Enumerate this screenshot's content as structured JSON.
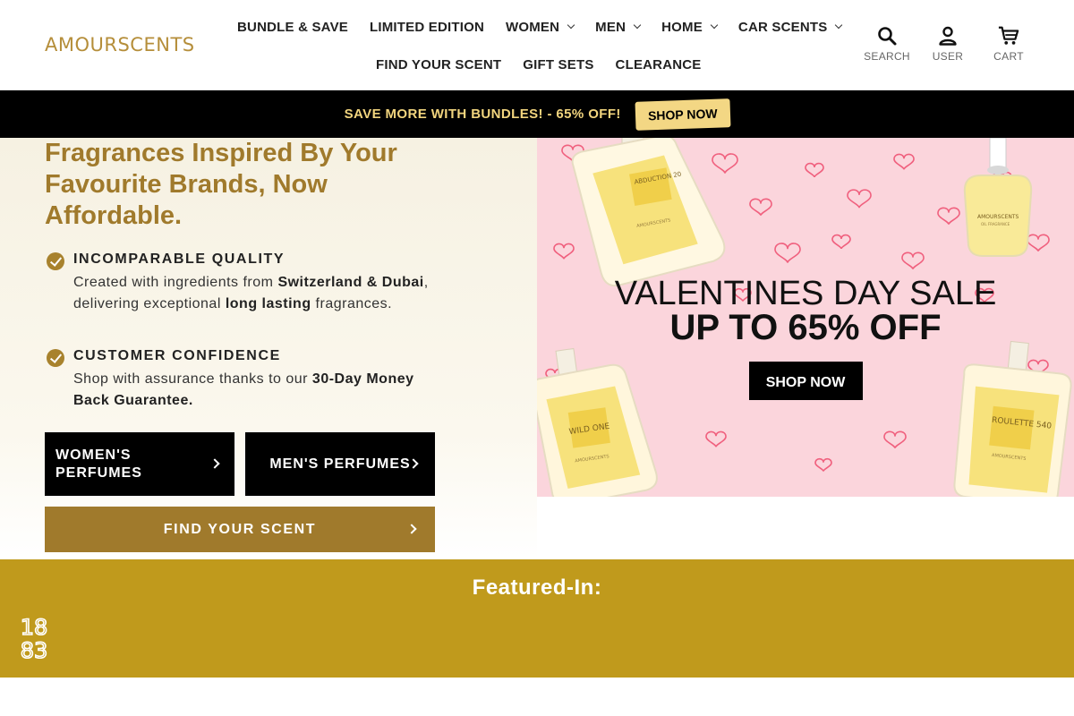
{
  "header": {
    "logo": "AMOURSCENTS",
    "nav_row1": [
      {
        "label": "BUNDLE & SAVE",
        "dropdown": false
      },
      {
        "label": "LIMITED EDITION",
        "dropdown": false
      },
      {
        "label": "WOMEN",
        "dropdown": true
      },
      {
        "label": "MEN",
        "dropdown": true
      },
      {
        "label": "HOME",
        "dropdown": true
      },
      {
        "label": "CAR SCENTS",
        "dropdown": true
      }
    ],
    "nav_row2": [
      {
        "label": "FIND YOUR SCENT"
      },
      {
        "label": "GIFT SETS"
      },
      {
        "label": "CLEARANCE"
      }
    ],
    "icons": {
      "search": "SEARCH",
      "user": "USER",
      "cart": "CART"
    }
  },
  "banner": {
    "text": "SAVE MORE WITH BUNDLES! - 65% OFF!",
    "button": "SHOP NOW"
  },
  "hero": {
    "title": "Fragrances Inspired By Your Favourite Brands, Now Affordable.",
    "features": [
      {
        "heading": "INCOMPARABLE QUALITY",
        "body_parts": [
          "Created with ingredients from ",
          "Switzerland & Dubai",
          ", delivering exceptional ",
          "long lasting",
          " fragrances."
        ]
      },
      {
        "heading": "CUSTOMER CONFIDENCE",
        "body_parts": [
          "Shop with assurance thanks to our ",
          "30-Day Money Back Guarantee."
        ]
      }
    ],
    "cta_women": "WOMEN'S PERFUMES",
    "cta_men": "MEN'S PERFUMES",
    "cta_find": "FIND YOUR SCENT"
  },
  "promo": {
    "line1": "VALENTINES DAY SALE",
    "line2": "UP TO 65% OFF",
    "button": "SHOP NOW",
    "bottles": [
      {
        "name": "ABDUCTION 20",
        "brand": "AMOURSCENTS"
      },
      {
        "name": "AMOURSCENTS",
        "brand": "OIL FRAGRANCE"
      },
      {
        "name": "WILD ONE",
        "brand": "AMOURSCENTS"
      },
      {
        "name": "ROULETTE 540",
        "brand": "AMOURSCENTS"
      }
    ],
    "bg_color": "#fbd5dc",
    "heart_color": "#f0607e"
  },
  "featured": {
    "title": "Featured-In:",
    "logo_text_top": "18",
    "logo_text_bottom": "83",
    "bg_color": "#c09a1c"
  },
  "colors": {
    "brand_gold": "#a07a2c",
    "banner_bg": "#000000",
    "banner_text": "#f2d57e"
  }
}
